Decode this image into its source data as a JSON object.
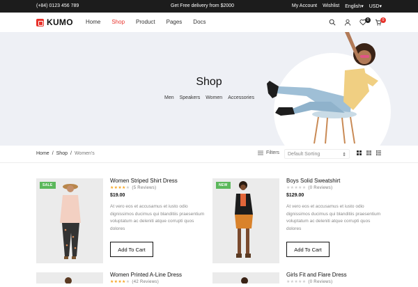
{
  "topbar": {
    "phone": "(+84) 0123 456 789",
    "promo": "Get Free delivery from $2000",
    "my_account": "My Account",
    "wishlist": "Wishlist",
    "language": "English",
    "currency": "USD"
  },
  "header": {
    "logo": "KUMO",
    "nav": [
      "Home",
      "Shop",
      "Product",
      "Pages",
      "Docs"
    ],
    "active_nav": "Shop",
    "wishlist_count": "0",
    "cart_count": "0",
    "icons": [
      "search-icon",
      "user-icon",
      "heart-icon",
      "cart-icon"
    ]
  },
  "hero": {
    "title": "Shop",
    "categories": [
      "Men",
      "Speakers",
      "Women",
      "Accessories"
    ]
  },
  "toolbar": {
    "breadcrumb": [
      "Home",
      "Shop",
      "Women's"
    ],
    "filters_label": "Filters",
    "sort_value": "Default Sorting"
  },
  "products": [
    {
      "tag": "SALE",
      "name": "Women Striped Shirt Dress",
      "rating": 4,
      "reviews": "(5 Reviews)",
      "price": "$19.00",
      "description": "At vero eos et accusamus et iusto odio dignissimos ducimus qui blanditiis praesentium voluptatum ac deleniti atque corrupti quos dolores",
      "button": "Add To Cart"
    },
    {
      "tag": "NEW",
      "name": "Boys Solid Sweatshirt",
      "rating": 0,
      "reviews": "(0 Reviews)",
      "price": "$129.00",
      "description": "At vero eos et accusamus et iusto odio dignissimos ducimus qui blanditiis praesentium voluptatum ac deleniti atque corrupti quos dolores",
      "button": "Add To Cart"
    },
    {
      "name": "Women Printed A-Line Dress",
      "rating": 4,
      "reviews": "(42 Reviews)"
    },
    {
      "name": "Girls Fit and Flare Dress",
      "rating": 0,
      "reviews": "(0 Reviews)"
    }
  ],
  "colors": {
    "accent": "#e8332c",
    "sale": "#5cb85c",
    "new": "#5cb85c",
    "topbar": "#1c1c1c",
    "hero_bg": "#eef0f5"
  }
}
